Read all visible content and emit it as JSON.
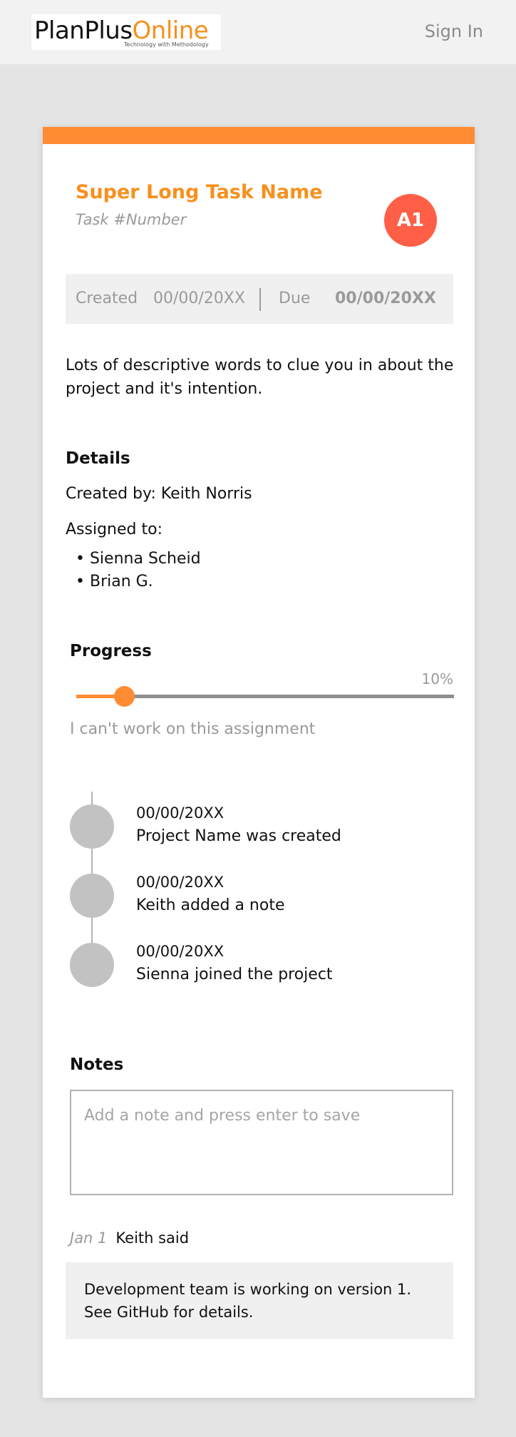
{
  "header": {
    "logo_plan": "PlanPlus",
    "logo_online": "Online",
    "logo_tagline": "Technology with Methodology",
    "sign_in": "Sign In"
  },
  "colors": {
    "accent": "#ff8b33",
    "title": "#f7901e",
    "avatar": "#ff5f47"
  },
  "task": {
    "title": "Super Long Task Name",
    "number": "Task #Number",
    "avatar": "A1",
    "created_label": "Created",
    "created_date": "00/00/20XX",
    "due_label": "Due",
    "due_date": "00/00/20XX",
    "description": "Lots of descriptive words to clue you in about the project and it's intention."
  },
  "details": {
    "heading": "Details",
    "created_by": "Created by: Keith Norris",
    "assigned_label": "Assigned to:",
    "assignees": [
      "• Sienna Scheid",
      "• Brian G."
    ]
  },
  "progress": {
    "heading": "Progress",
    "percent_label": "10%",
    "value": 0.1,
    "cant_work": "I can't work on this assignment"
  },
  "timeline": [
    {
      "date": "00/00/20XX",
      "text": "Project Name was created"
    },
    {
      "date": "00/00/20XX",
      "text": "Keith added a note"
    },
    {
      "date": "00/00/20XX",
      "text": "Sienna joined the project"
    }
  ],
  "notes": {
    "heading": "Notes",
    "placeholder": "Add a note and press enter to save",
    "items": [
      {
        "date": "Jan 1",
        "author": "Keith said",
        "body": "Development team is working on version 1. See GitHub for details."
      }
    ]
  }
}
